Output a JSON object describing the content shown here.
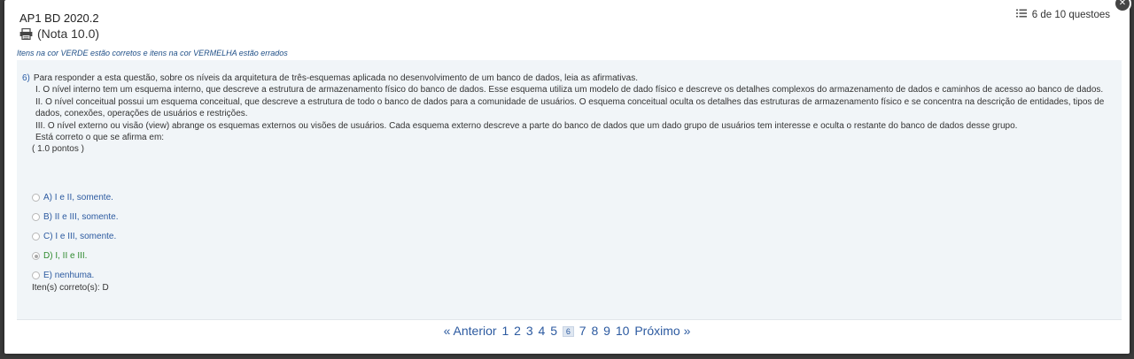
{
  "header": {
    "title": "AP1 BD 2020.2",
    "grade": "(Nota 10.0)",
    "counter": "6 de 10 questoes"
  },
  "legend": "Itens na cor VERDE estão corretos e itens na cor VERMELHA estão errados",
  "question": {
    "number": "6)",
    "intro": "Para responder a esta questão, sobre os níveis da arquitetura de três-esquemas aplicada no desenvolvimento de um banco de dados, leia as afirmativas.",
    "item1": "I. O nível interno tem um esquema interno, que descreve a estrutura de armazenamento físico do banco de dados. Esse esquema utiliza um modelo de dado físico e descreve os detalhes complexos do armazenamento de dados e caminhos de acesso ao banco de dados.",
    "item2": "II. O nível conceitual possui um esquema conceitual, que descreve a estrutura de todo o banco de dados para a comunidade de usuários. O esquema conceitual oculta os detalhes das estruturas de armazenamento físico e se concentra na descrição de entidades, tipos de dados, conexões, operações de usuários e restrições.",
    "item3": "III. O nível externo ou visão (view) abrange os esquemas externos ou visões de usuários. Cada esquema externo descreve a parte do banco de dados que um dado grupo de usuários tem interesse e oculta o restante do banco de dados desse grupo.",
    "prompt": "Está correto o que se afirma em:",
    "points": "( 1.0 pontos )",
    "options": [
      {
        "label": "A) I e II, somente."
      },
      {
        "label": "B) II e III, somente."
      },
      {
        "label": "C) I e III, somente."
      },
      {
        "label": "D) I, II e III."
      },
      {
        "label": "E) nenhuma."
      }
    ],
    "answer": "Iten(s) correto(s): D"
  },
  "pager": {
    "prev": "« Anterior",
    "pages": [
      "1",
      "2",
      "3",
      "4",
      "5",
      "6",
      "7",
      "8",
      "9",
      "10"
    ],
    "current": "6",
    "next": "Próximo »"
  },
  "colors": {
    "link": "#2c5aa0",
    "correct": "#2f8a2f",
    "panel": "#f1f5f8"
  }
}
